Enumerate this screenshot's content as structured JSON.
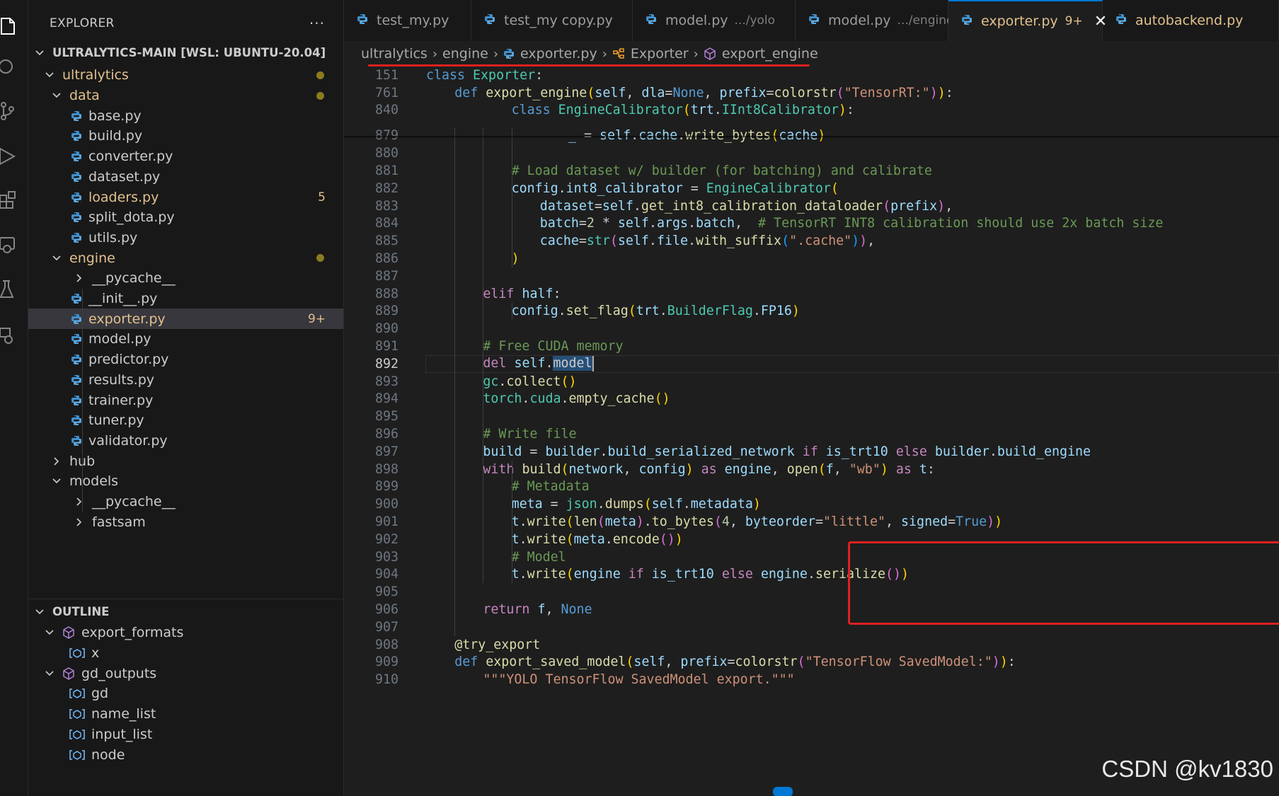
{
  "activity_bar": {
    "icons": [
      "files-icon",
      "search-icon",
      "source-control-icon",
      "run-debug-icon",
      "extensions-icon",
      "remote-explorer-icon",
      "testing-icon",
      "docker-icon"
    ]
  },
  "explorer": {
    "title": "EXPLORER",
    "more": "···",
    "workspace": "ULTRALYTICS-MAIN [WSL: UBUNTU-20.04]",
    "items": [
      {
        "label": "ultralytics",
        "kind": "folder-open",
        "depth": 1,
        "modified": true,
        "dot": true
      },
      {
        "label": "data",
        "kind": "folder-open",
        "depth": 2,
        "modified": true,
        "dot": true
      },
      {
        "label": "base.py",
        "kind": "py",
        "depth": 3
      },
      {
        "label": "build.py",
        "kind": "py",
        "depth": 3
      },
      {
        "label": "converter.py",
        "kind": "py",
        "depth": 3
      },
      {
        "label": "dataset.py",
        "kind": "py",
        "depth": 3
      },
      {
        "label": "loaders.py",
        "kind": "py",
        "depth": 3,
        "modified": true,
        "badge": "5"
      },
      {
        "label": "split_dota.py",
        "kind": "py",
        "depth": 3
      },
      {
        "label": "utils.py",
        "kind": "py",
        "depth": 3
      },
      {
        "label": "engine",
        "kind": "folder-open",
        "depth": 2,
        "modified": true,
        "dot": true
      },
      {
        "label": "__pycache__",
        "kind": "folder-closed",
        "depth": 3
      },
      {
        "label": "__init__.py",
        "kind": "py",
        "depth": 3
      },
      {
        "label": "exporter.py",
        "kind": "py",
        "depth": 3,
        "modified": true,
        "badge": "9+",
        "selected": true
      },
      {
        "label": "model.py",
        "kind": "py",
        "depth": 3
      },
      {
        "label": "predictor.py",
        "kind": "py",
        "depth": 3
      },
      {
        "label": "results.py",
        "kind": "py",
        "depth": 3
      },
      {
        "label": "trainer.py",
        "kind": "py",
        "depth": 3
      },
      {
        "label": "tuner.py",
        "kind": "py",
        "depth": 3
      },
      {
        "label": "validator.py",
        "kind": "py",
        "depth": 3
      },
      {
        "label": "hub",
        "kind": "folder-closed",
        "depth": 2
      },
      {
        "label": "models",
        "kind": "folder-open",
        "depth": 2
      },
      {
        "label": "__pycache__",
        "kind": "folder-closed",
        "depth": 3
      },
      {
        "label": "fastsam",
        "kind": "folder-closed",
        "depth": 3
      }
    ]
  },
  "outline": {
    "title": "OUTLINE",
    "items": [
      {
        "label": "export_formats",
        "kind": "module",
        "depth": 1,
        "open": true
      },
      {
        "label": "x",
        "kind": "variable",
        "depth": 2
      },
      {
        "label": "gd_outputs",
        "kind": "module",
        "depth": 1,
        "open": true
      },
      {
        "label": "gd",
        "kind": "variable",
        "depth": 2
      },
      {
        "label": "name_list",
        "kind": "variable",
        "depth": 2
      },
      {
        "label": "input_list",
        "kind": "variable",
        "depth": 2
      },
      {
        "label": "node",
        "kind": "variable",
        "depth": 2
      }
    ]
  },
  "tabs": [
    {
      "name": "test_my.py",
      "desc": "",
      "active": false
    },
    {
      "name": "test_my copy.py",
      "desc": "",
      "active": false
    },
    {
      "name": "model.py",
      "desc": ".../yolo",
      "active": false
    },
    {
      "name": "model.py",
      "desc": ".../engine",
      "active": false
    },
    {
      "name": "exporter.py",
      "desc": "",
      "badge": "9+",
      "active": true,
      "close": "✕"
    },
    {
      "name": "autobackend.py",
      "desc": "",
      "active": false,
      "modified": true
    }
  ],
  "breadcrumb": {
    "items": [
      "ultralytics",
      "engine",
      "exporter.py",
      "Exporter",
      "export_engine"
    ],
    "separator": "›"
  },
  "sticky_lines": [
    {
      "num": "151",
      "indent": 0,
      "tokens": [
        [
          "k",
          "class"
        ],
        [
          "t",
          " "
        ],
        [
          "c",
          "Exporter"
        ],
        [
          "t",
          ":"
        ]
      ]
    },
    {
      "num": "761",
      "indent": 1,
      "tokens": [
        [
          "k",
          "def"
        ],
        [
          "t",
          " "
        ],
        [
          "f",
          "export_engine"
        ],
        [
          "br1",
          "("
        ],
        [
          "v",
          "self"
        ],
        [
          "t",
          ", "
        ],
        [
          "v",
          "dla"
        ],
        [
          "t",
          "="
        ],
        [
          "k",
          "None"
        ],
        [
          "t",
          ", "
        ],
        [
          "v",
          "prefix"
        ],
        [
          "t",
          "="
        ],
        [
          "f",
          "colorstr"
        ],
        [
          "br2",
          "("
        ],
        [
          "s",
          "\"TensorRT:\""
        ],
        [
          "br2",
          ")"
        ],
        [
          "br1",
          ")"
        ],
        [
          "t",
          ":"
        ]
      ]
    },
    {
      "num": "840",
      "indent": 3,
      "tokens": [
        [
          "k",
          "class"
        ],
        [
          "t",
          " "
        ],
        [
          "c",
          "EngineCalibrator"
        ],
        [
          "br1",
          "("
        ],
        [
          "v",
          "trt"
        ],
        [
          "t",
          "."
        ],
        [
          "c",
          "IInt8Calibrator"
        ],
        [
          "br1",
          ")"
        ],
        [
          "t",
          ":"
        ]
      ]
    }
  ],
  "code_lines": [
    {
      "num": "879",
      "indent": 5,
      "tokens": [
        [
          "v",
          "_"
        ],
        [
          "t",
          " = "
        ],
        [
          "v",
          "self"
        ],
        [
          "t",
          "."
        ],
        [
          "v",
          "cache"
        ],
        [
          "t",
          "."
        ],
        [
          "f",
          "write_bytes"
        ],
        [
          "br1",
          "("
        ],
        [
          "v",
          "cache"
        ],
        [
          "br1",
          ")"
        ]
      ]
    },
    {
      "num": "880",
      "indent": 0,
      "tokens": []
    },
    {
      "num": "881",
      "indent": 3,
      "tokens": [
        [
          "cm",
          "# Load dataset w/ builder (for batching) and calibrate"
        ]
      ]
    },
    {
      "num": "882",
      "indent": 3,
      "tokens": [
        [
          "v",
          "config"
        ],
        [
          "t",
          "."
        ],
        [
          "v",
          "int8_calibrator"
        ],
        [
          "t",
          " = "
        ],
        [
          "c",
          "EngineCalibrator"
        ],
        [
          "br1",
          "("
        ]
      ]
    },
    {
      "num": "883",
      "indent": 4,
      "tokens": [
        [
          "v",
          "dataset"
        ],
        [
          "t",
          "="
        ],
        [
          "v",
          "self"
        ],
        [
          "t",
          "."
        ],
        [
          "f",
          "get_int8_calibration_dataloader"
        ],
        [
          "br2",
          "("
        ],
        [
          "v",
          "prefix"
        ],
        [
          "br2",
          ")"
        ],
        [
          "t",
          ","
        ]
      ]
    },
    {
      "num": "884",
      "indent": 4,
      "tokens": [
        [
          "v",
          "batch"
        ],
        [
          "t",
          "="
        ],
        [
          "n",
          "2"
        ],
        [
          "t",
          " * "
        ],
        [
          "v",
          "self"
        ],
        [
          "t",
          "."
        ],
        [
          "v",
          "args"
        ],
        [
          "t",
          "."
        ],
        [
          "v",
          "batch"
        ],
        [
          "t",
          ",  "
        ],
        [
          "cm",
          "# TensorRT INT8 calibration should use 2x batch size"
        ]
      ]
    },
    {
      "num": "885",
      "indent": 4,
      "tokens": [
        [
          "v",
          "cache"
        ],
        [
          "t",
          "="
        ],
        [
          "c",
          "str"
        ],
        [
          "br2",
          "("
        ],
        [
          "v",
          "self"
        ],
        [
          "t",
          "."
        ],
        [
          "v",
          "file"
        ],
        [
          "t",
          "."
        ],
        [
          "f",
          "with_suffix"
        ],
        [
          "br3",
          "("
        ],
        [
          "s",
          "\".cache\""
        ],
        [
          "br3",
          ")"
        ],
        [
          "br2",
          ")"
        ],
        [
          "t",
          ","
        ]
      ]
    },
    {
      "num": "886",
      "indent": 3,
      "tokens": [
        [
          "br1",
          ")"
        ]
      ]
    },
    {
      "num": "887",
      "indent": 0,
      "tokens": []
    },
    {
      "num": "888",
      "indent": 2,
      "tokens": [
        [
          "kc",
          "elif"
        ],
        [
          "t",
          " "
        ],
        [
          "v",
          "half"
        ],
        [
          "t",
          ":"
        ]
      ]
    },
    {
      "num": "889",
      "indent": 3,
      "tokens": [
        [
          "v",
          "config"
        ],
        [
          "t",
          "."
        ],
        [
          "f",
          "set_flag"
        ],
        [
          "br1",
          "("
        ],
        [
          "v",
          "trt"
        ],
        [
          "t",
          "."
        ],
        [
          "c",
          "BuilderFlag"
        ],
        [
          "t",
          "."
        ],
        [
          "v",
          "FP16"
        ],
        [
          "br1",
          ")"
        ]
      ]
    },
    {
      "num": "890",
      "indent": 0,
      "tokens": []
    },
    {
      "num": "891",
      "indent": 2,
      "tokens": [
        [
          "cm",
          "# Free CUDA memory"
        ]
      ]
    },
    {
      "num": "892",
      "indent": 2,
      "current": true,
      "tokens": [
        [
          "kc",
          "del"
        ],
        [
          "t",
          " "
        ],
        [
          "v",
          "self"
        ],
        [
          "t",
          "."
        ],
        [
          "sel",
          "model"
        ],
        [
          "caret",
          ""
        ]
      ]
    },
    {
      "num": "893",
      "indent": 2,
      "tokens": [
        [
          "c",
          "gc"
        ],
        [
          "t",
          "."
        ],
        [
          "f",
          "collect"
        ],
        [
          "br1",
          "()"
        ]
      ]
    },
    {
      "num": "894",
      "indent": 2,
      "tokens": [
        [
          "c",
          "torch"
        ],
        [
          "t",
          "."
        ],
        [
          "c",
          "cuda"
        ],
        [
          "t",
          "."
        ],
        [
          "f",
          "empty_cache"
        ],
        [
          "br1",
          "()"
        ]
      ]
    },
    {
      "num": "895",
      "indent": 0,
      "tokens": []
    },
    {
      "num": "896",
      "indent": 2,
      "tokens": [
        [
          "cm",
          "# Write file"
        ]
      ]
    },
    {
      "num": "897",
      "indent": 2,
      "tokens": [
        [
          "v",
          "build"
        ],
        [
          "t",
          " = "
        ],
        [
          "v",
          "builder"
        ],
        [
          "t",
          "."
        ],
        [
          "v",
          "build_serialized_network"
        ],
        [
          "t",
          " "
        ],
        [
          "kc",
          "if"
        ],
        [
          "t",
          " "
        ],
        [
          "v",
          "is_trt10"
        ],
        [
          "t",
          " "
        ],
        [
          "kc",
          "else"
        ],
        [
          "t",
          " "
        ],
        [
          "v",
          "builder"
        ],
        [
          "t",
          "."
        ],
        [
          "v",
          "build_engine"
        ]
      ]
    },
    {
      "num": "898",
      "indent": 2,
      "tokens": [
        [
          "kc",
          "with"
        ],
        [
          "t",
          " "
        ],
        [
          "f",
          "build"
        ],
        [
          "br1",
          "("
        ],
        [
          "v",
          "network"
        ],
        [
          "t",
          ", "
        ],
        [
          "v",
          "config"
        ],
        [
          "br1",
          ")"
        ],
        [
          "t",
          " "
        ],
        [
          "kc",
          "as"
        ],
        [
          "t",
          " "
        ],
        [
          "v",
          "engine"
        ],
        [
          "t",
          ", "
        ],
        [
          "f",
          "open"
        ],
        [
          "br1",
          "("
        ],
        [
          "v",
          "f"
        ],
        [
          "t",
          ", "
        ],
        [
          "s",
          "\"wb\""
        ],
        [
          "br1",
          ")"
        ],
        [
          "t",
          " "
        ],
        [
          "kc",
          "as"
        ],
        [
          "t",
          " "
        ],
        [
          "v",
          "t"
        ],
        [
          "t",
          ":"
        ]
      ]
    },
    {
      "num": "899",
      "indent": 3,
      "tokens": [
        [
          "cm",
          "# Metadata"
        ]
      ]
    },
    {
      "num": "900",
      "indent": 3,
      "tokens": [
        [
          "v",
          "meta"
        ],
        [
          "t",
          " = "
        ],
        [
          "c",
          "json"
        ],
        [
          "t",
          "."
        ],
        [
          "f",
          "dumps"
        ],
        [
          "br1",
          "("
        ],
        [
          "v",
          "self"
        ],
        [
          "t",
          "."
        ],
        [
          "v",
          "metadata"
        ],
        [
          "br1",
          ")"
        ]
      ]
    },
    {
      "num": "901",
      "indent": 3,
      "tokens": [
        [
          "v",
          "t"
        ],
        [
          "t",
          "."
        ],
        [
          "f",
          "write"
        ],
        [
          "br1",
          "("
        ],
        [
          "f",
          "len"
        ],
        [
          "br2",
          "("
        ],
        [
          "v",
          "meta"
        ],
        [
          "br2",
          ")"
        ],
        [
          "t",
          "."
        ],
        [
          "f",
          "to_bytes"
        ],
        [
          "br2",
          "("
        ],
        [
          "n",
          "4"
        ],
        [
          "t",
          ", "
        ],
        [
          "v",
          "byteorder"
        ],
        [
          "t",
          "="
        ],
        [
          "s",
          "\"little\""
        ],
        [
          "t",
          ", "
        ],
        [
          "v",
          "signed"
        ],
        [
          "t",
          "="
        ],
        [
          "k",
          "True"
        ],
        [
          "br2",
          ")"
        ],
        [
          "br1",
          ")"
        ]
      ]
    },
    {
      "num": "902",
      "indent": 3,
      "tokens": [
        [
          "v",
          "t"
        ],
        [
          "t",
          "."
        ],
        [
          "f",
          "write"
        ],
        [
          "br1",
          "("
        ],
        [
          "v",
          "meta"
        ],
        [
          "t",
          "."
        ],
        [
          "f",
          "encode"
        ],
        [
          "br2",
          "()"
        ],
        [
          "br1",
          ")"
        ]
      ]
    },
    {
      "num": "903",
      "indent": 3,
      "tokens": [
        [
          "cm",
          "# Model"
        ]
      ]
    },
    {
      "num": "904",
      "indent": 3,
      "tokens": [
        [
          "v",
          "t"
        ],
        [
          "t",
          "."
        ],
        [
          "f",
          "write"
        ],
        [
          "br1",
          "("
        ],
        [
          "v",
          "engine"
        ],
        [
          "t",
          " "
        ],
        [
          "kc",
          "if"
        ],
        [
          "t",
          " "
        ],
        [
          "v",
          "is_trt10"
        ],
        [
          "t",
          " "
        ],
        [
          "kc",
          "else"
        ],
        [
          "t",
          " "
        ],
        [
          "v",
          "engine"
        ],
        [
          "t",
          "."
        ],
        [
          "f",
          "serialize"
        ],
        [
          "br2",
          "()"
        ],
        [
          "br1",
          ")"
        ]
      ]
    },
    {
      "num": "905",
      "indent": 0,
      "tokens": []
    },
    {
      "num": "906",
      "indent": 2,
      "tokens": [
        [
          "kc",
          "return"
        ],
        [
          "t",
          " "
        ],
        [
          "v",
          "f"
        ],
        [
          "t",
          ", "
        ],
        [
          "k",
          "None"
        ]
      ]
    },
    {
      "num": "907",
      "indent": 0,
      "tokens": []
    },
    {
      "num": "908",
      "indent": 1,
      "tokens": [
        [
          "f",
          "@try_export"
        ]
      ]
    },
    {
      "num": "909",
      "indent": 1,
      "tokens": [
        [
          "k",
          "def"
        ],
        [
          "t",
          " "
        ],
        [
          "f",
          "export_saved_model"
        ],
        [
          "br1",
          "("
        ],
        [
          "v",
          "self"
        ],
        [
          "t",
          ", "
        ],
        [
          "v",
          "prefix"
        ],
        [
          "t",
          "="
        ],
        [
          "f",
          "colorstr"
        ],
        [
          "br2",
          "("
        ],
        [
          "s",
          "\"TensorFlow SavedModel:\""
        ],
        [
          "br2",
          ")"
        ],
        [
          "br1",
          ")"
        ],
        [
          "t",
          ":"
        ]
      ]
    },
    {
      "num": "910",
      "indent": 2,
      "tokens": [
        [
          "s",
          "\"\"\"YOLO TensorFlow SavedModel export.\"\"\""
        ]
      ]
    }
  ],
  "watermark": "CSDN @kv1830",
  "colors": {
    "accent": "#0078d4",
    "modified": "#e2c08d",
    "annotation": "#e02020"
  }
}
